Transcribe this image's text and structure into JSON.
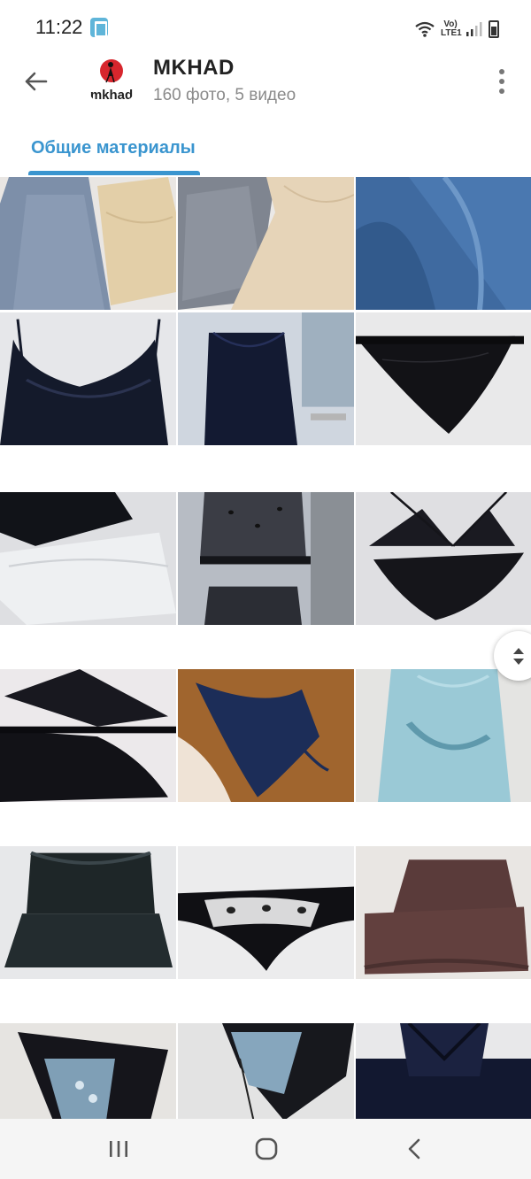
{
  "status_bar": {
    "time": "11:22",
    "network_label": "Vo)\nLTE1",
    "icons": [
      "app-notification-icon",
      "wifi-icon",
      "signal-icon",
      "battery-icon"
    ]
  },
  "header": {
    "avatar_text": "mkhad",
    "title": "MKHAD",
    "subtitle": "160 фото, 5 видео",
    "back_icon": "arrow-left-icon",
    "more_icon": "more-vertical-icon"
  },
  "tabs": [
    {
      "label": "Общие материалы",
      "active": true
    }
  ],
  "colors": {
    "accent": "#3a95cf",
    "title": "#222222",
    "subtitle": "#8a8a8a",
    "nav_bar": "#f5f5f5"
  },
  "grid": {
    "columns": 3,
    "photos": [
      {
        "subject": "blue and beige dresses"
      },
      {
        "subject": "grey and beige dresses"
      },
      {
        "subject": "blue satin fabric"
      },
      {
        "subject": "navy satin top on mannequin"
      },
      {
        "subject": "navy slip dress by window"
      },
      {
        "subject": "black mesh panties"
      },
      {
        "subject": "black and white lace lingerie"
      },
      {
        "subject": "polka dot sheer set"
      },
      {
        "subject": "black strappy lingerie set"
      },
      {
        "subject": "black strappy set close-up"
      },
      {
        "subject": "navy lace bra in hand"
      },
      {
        "subject": "light blue satin slip"
      },
      {
        "subject": "dark satin pajama set"
      },
      {
        "subject": "embroidered mesh panties"
      },
      {
        "subject": "brown satin pajama set"
      },
      {
        "subject": "embroidered black panties"
      },
      {
        "subject": "embroidered panties on hanger"
      },
      {
        "subject": "navy set on mannequin"
      }
    ]
  },
  "fast_scroll": {
    "icon": "fast-scroll-icon"
  },
  "nav_bar": {
    "buttons": [
      "recent-apps-icon",
      "home-icon",
      "back-icon"
    ]
  }
}
